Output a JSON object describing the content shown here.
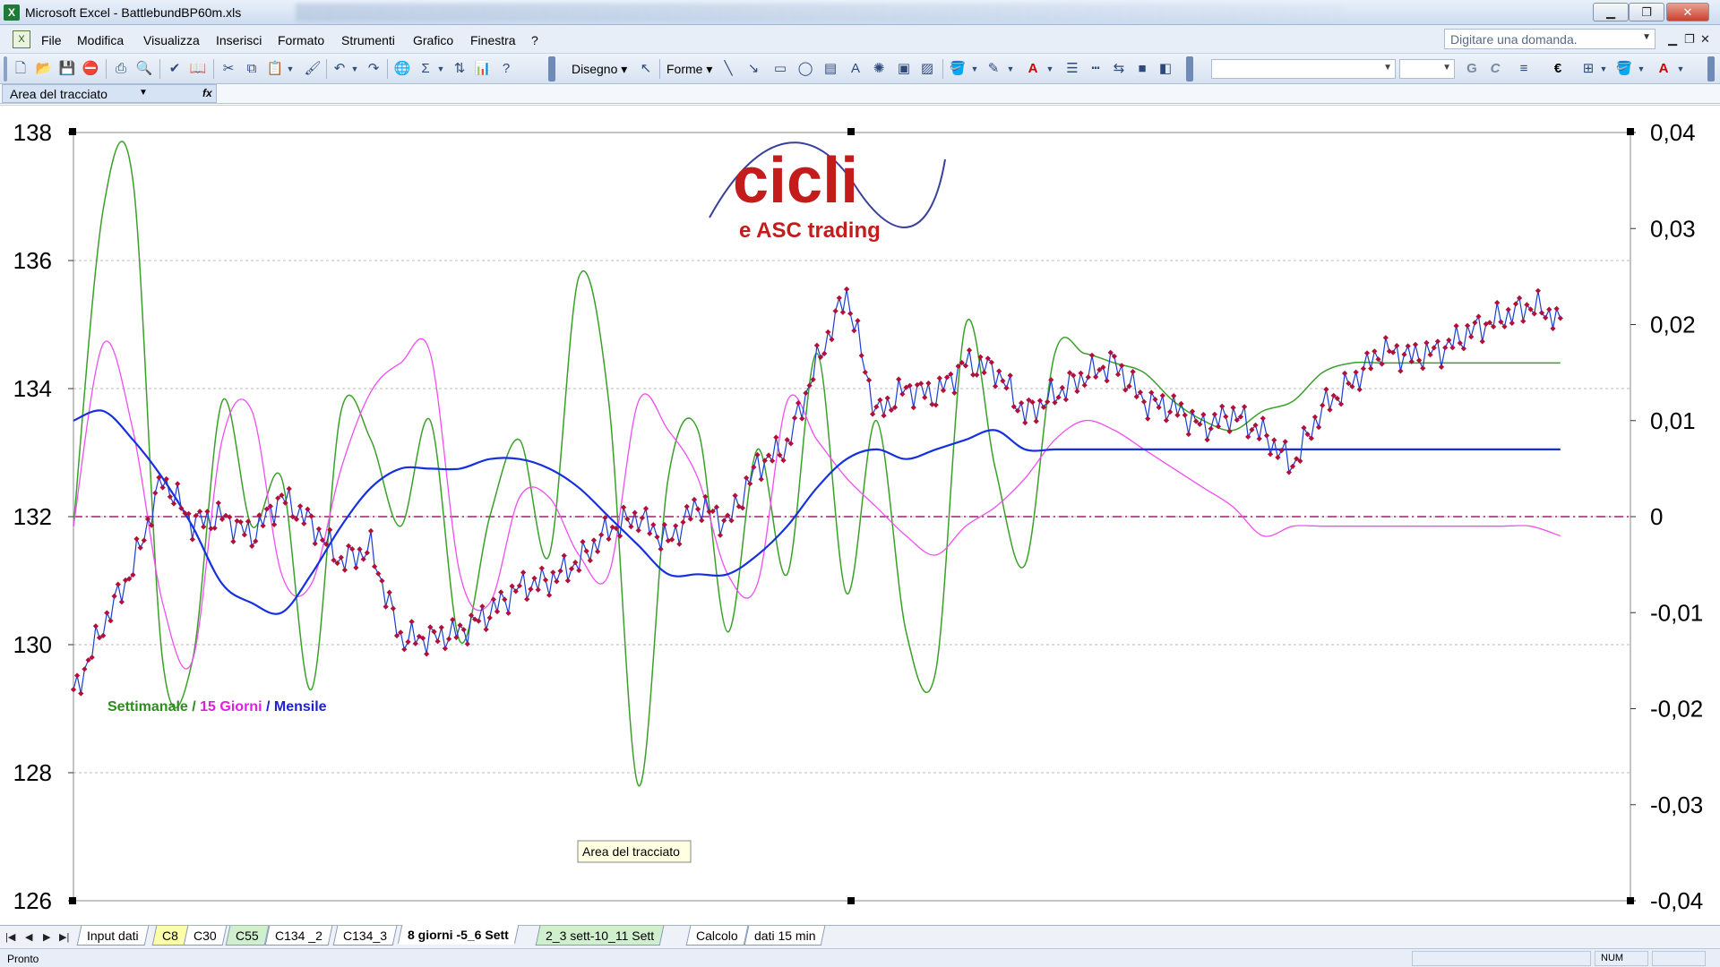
{
  "window": {
    "title": "Microsoft Excel - BattlebundBP60m.xls",
    "app_icon": "excel-icon",
    "buttons": {
      "minimize": "▁",
      "restore": "❐",
      "close": "✕"
    }
  },
  "menu": {
    "items": [
      "File",
      "Modifica",
      "Visualizza",
      "Inserisci",
      "Formato",
      "Strumenti",
      "Grafico",
      "Finestra",
      "?"
    ],
    "help_placeholder": "Digitare una domanda.",
    "window_controls": [
      "▁",
      "❐",
      "✕"
    ]
  },
  "toolbar": {
    "disegno_label": "Disegno ▾",
    "forme_label": "Forme ▾",
    "bold_g": "G",
    "italic_c": "C",
    "euro": "€"
  },
  "namebar": {
    "name_box": "Area del tracciato",
    "fx": "fx"
  },
  "chart": {
    "logo": {
      "top": "cicli",
      "bottom": "e ASC trading"
    },
    "tooltip": "Area del tracciato",
    "legend": [
      {
        "text": "Settimanale",
        "color": "#2e8b20"
      },
      {
        "text": " / ",
        "color": "#2e8b20"
      },
      {
        "text": "15 Giorni",
        "color": "#e020e0"
      },
      {
        "text": " / ",
        "color": "#2020e0"
      },
      {
        "text": "Mensile",
        "color": "#2020d0"
      }
    ],
    "colors": {
      "price_line": "#1a3fd0",
      "price_marker": "#b0103a",
      "settimanale": "#3aa02a",
      "quindici": "#f04ff0",
      "mensile": "#1530e0",
      "zero_line": "#a0206a"
    }
  },
  "chart_data": {
    "type": "line",
    "left_axis": {
      "min": 126,
      "max": 138,
      "ticks": [
        "126",
        "128",
        "130",
        "132",
        "134",
        "136",
        "138"
      ]
    },
    "right_axis": {
      "min": -0.04,
      "max": 0.04,
      "ticks": [
        "-0,04",
        "-0,03",
        "-0,02",
        "-0,01",
        "0",
        "0,01",
        "0,02",
        "0,03",
        "0,04"
      ]
    },
    "grid": true,
    "x": [
      0,
      2,
      4,
      6,
      8,
      10,
      12,
      14,
      16,
      18,
      20,
      22,
      24,
      26,
      28,
      30,
      32,
      34,
      36,
      38,
      40,
      42,
      44,
      46,
      48,
      50,
      52,
      54,
      56,
      58,
      60,
      62,
      64,
      66,
      68,
      70,
      72,
      74,
      76,
      78,
      80,
      82,
      84,
      86,
      88,
      90,
      92,
      94,
      96,
      98,
      100
    ],
    "price": [
      129.2,
      130.3,
      131.2,
      132.6,
      131.9,
      132.0,
      131.7,
      132.3,
      131.9,
      131.3,
      131.5,
      130.1,
      130.1,
      130.2,
      130.5,
      130.9,
      131.0,
      131.3,
      131.8,
      132.0,
      131.6,
      132.2,
      131.9,
      132.8,
      133.1,
      134.4,
      135.5,
      133.6,
      134.0,
      133.9,
      134.4,
      134.3,
      133.6,
      133.9,
      134.2,
      134.4,
      133.8,
      133.7,
      133.4,
      133.6,
      133.3,
      132.8,
      133.7,
      134.1,
      134.6,
      134.5,
      134.6,
      134.9,
      135.1,
      135.3,
      135.1
    ],
    "settimanale": [
      -0.001,
      0.032,
      0.035,
      -0.015,
      -0.015,
      0.012,
      -0.001,
      0.004,
      -0.018,
      0.011,
      0.008,
      -0.001,
      0.01,
      -0.013,
      0.0,
      0.008,
      -0.004,
      0.025,
      0.012,
      -0.028,
      0.004,
      0.009,
      -0.012,
      0.007,
      -0.006,
      0.017,
      -0.008,
      0.01,
      -0.012,
      -0.016,
      0.02,
      0.005,
      -0.005,
      0.017,
      0.017,
      0.016,
      0.015,
      0.012,
      0.01,
      0.009,
      0.011,
      0.012,
      0.015,
      0.016,
      0.016,
      0.016,
      0.016,
      0.016,
      0.016,
      0.016,
      0.016
    ],
    "quindici": [
      -0.001,
      0.018,
      0.009,
      -0.009,
      -0.015,
      0.008,
      0.011,
      -0.006,
      -0.007,
      0.005,
      0.013,
      0.016,
      0.017,
      -0.006,
      -0.009,
      0.002,
      0.002,
      -0.004,
      -0.006,
      0.012,
      0.009,
      0.004,
      -0.006,
      -0.007,
      0.012,
      0.008,
      0.004,
      0.001,
      -0.002,
      -0.004,
      -0.001,
      0.001,
      0.004,
      0.008,
      0.01,
      0.009,
      0.007,
      0.005,
      0.003,
      0.001,
      -0.002,
      -0.001,
      -0.001,
      -0.001,
      -0.001,
      -0.001,
      -0.001,
      -0.001,
      -0.001,
      -0.001,
      -0.002
    ],
    "mensile": [
      0.01,
      0.011,
      0.008,
      0.004,
      -0.001,
      -0.007,
      -0.009,
      -0.01,
      -0.006,
      -0.001,
      0.003,
      0.005,
      0.005,
      0.005,
      0.006,
      0.006,
      0.005,
      0.003,
      0.0,
      -0.003,
      -0.006,
      -0.006,
      -0.006,
      -0.004,
      -0.001,
      0.003,
      0.006,
      0.007,
      0.006,
      0.007,
      0.008,
      0.009,
      0.007,
      0.007,
      0.007,
      0.007,
      0.007,
      0.007,
      0.007,
      0.007,
      0.007,
      0.007,
      0.007,
      0.007,
      0.007,
      0.007,
      0.007,
      0.007,
      0.007,
      0.007,
      0.007
    ]
  },
  "sheets": {
    "tabs": [
      {
        "label": "Input dati",
        "style": ""
      },
      {
        "label": "C8",
        "style": "yellow"
      },
      {
        "label": "C30",
        "style": ""
      },
      {
        "label": "C55",
        "style": "green"
      },
      {
        "label": "C134 _2",
        "style": ""
      },
      {
        "label": "C134_3",
        "style": ""
      },
      {
        "label": "8 giorni -5_6 Sett",
        "style": "active"
      },
      {
        "label": "2_3 sett-10_11 Sett",
        "style": "green"
      },
      {
        "label": "Calcolo",
        "style": ""
      },
      {
        "label": "dati 15 min",
        "style": ""
      }
    ]
  },
  "status": {
    "text": "Pronto",
    "num": "NUM"
  }
}
